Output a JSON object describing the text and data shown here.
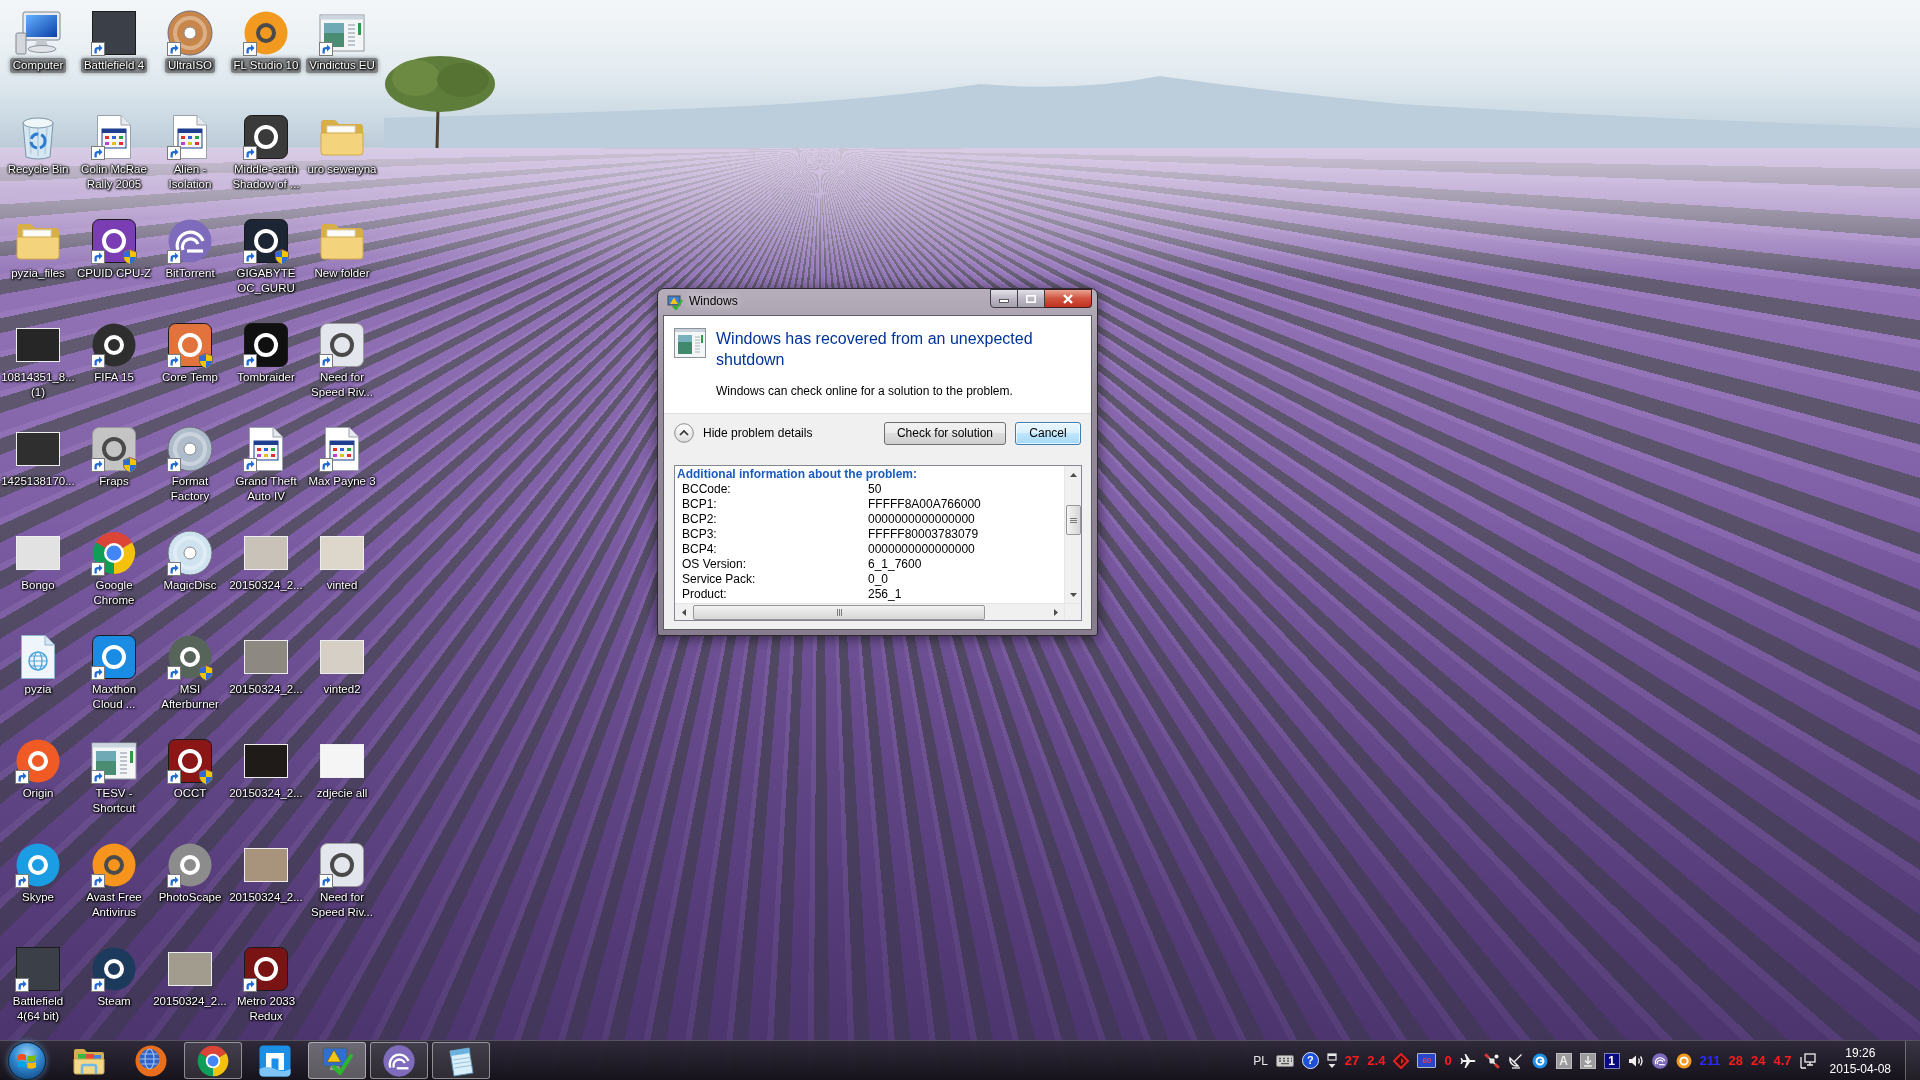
{
  "desktop_icons": [
    {
      "label": "Computer",
      "kind": "computer",
      "shortcut": false,
      "shield": false
    },
    {
      "label": "Battlefield 4",
      "kind": "cover",
      "color": "#3b3f47",
      "shortcut": true,
      "shield": false
    },
    {
      "label": "UltraISO",
      "kind": "disc",
      "color": "#c8864a",
      "shortcut": true,
      "shield": false
    },
    {
      "label": "FL Studio 10",
      "kind": "round",
      "color": "#f29a1f",
      "shortcut": true,
      "shield": false
    },
    {
      "label": "Vindictus EU",
      "kind": "window",
      "shortcut": true,
      "shield": false
    },
    {
      "label": "Recycle Bin",
      "kind": "recyclebin",
      "shortcut": false,
      "shield": false
    },
    {
      "label": "Colin McRae Rally 2005",
      "kind": "document",
      "shortcut": true,
      "shield": false
    },
    {
      "label": "Alien - Isolation",
      "kind": "document",
      "shortcut": true,
      "shield": false
    },
    {
      "label": "Middle-earth Shadow of ...",
      "kind": "tile",
      "color": "#3a3a3a",
      "shortcut": true,
      "shield": false
    },
    {
      "label": "uro seweryna",
      "kind": "folder",
      "shortcut": false,
      "shield": false
    },
    {
      "label": "pyzia_files",
      "kind": "folder",
      "shortcut": false,
      "shield": false
    },
    {
      "label": "CPUID CPU-Z",
      "kind": "tile",
      "color": "#7a3db3",
      "shortcut": true,
      "shield": true
    },
    {
      "label": "BitTorrent",
      "kind": "torrent",
      "shortcut": true,
      "shield": false
    },
    {
      "label": "GIGABYTE OC_GURU",
      "kind": "tile",
      "color": "#1c2533",
      "shortcut": true,
      "shield": true
    },
    {
      "label": "New folder",
      "kind": "folder",
      "shortcut": false,
      "shield": false
    },
    {
      "label": "10814351_8... (1)",
      "kind": "photo",
      "color": "#262626",
      "shortcut": false,
      "shield": false
    },
    {
      "label": "FIFA 15",
      "kind": "round",
      "color": "#2e2e2e",
      "shortcut": true,
      "shield": false
    },
    {
      "label": "Core Temp",
      "kind": "tile",
      "color": "#e2733c",
      "shortcut": true,
      "shield": true
    },
    {
      "label": "Tombraider",
      "kind": "tile",
      "color": "#101010",
      "shortcut": true,
      "shield": false
    },
    {
      "label": "Need for Speed Riv...",
      "kind": "tile",
      "color": "#e4e6ee",
      "shortcut": true,
      "shield": false
    },
    {
      "label": "1425138170...",
      "kind": "photo",
      "color": "#2f2f2f",
      "shortcut": false,
      "shield": false
    },
    {
      "label": "Fraps",
      "kind": "tile",
      "color": "#c4c4c4",
      "shortcut": true,
      "shield": true
    },
    {
      "label": "Format Factory",
      "kind": "disc",
      "color": "#aebccb",
      "shortcut": true,
      "shield": false
    },
    {
      "label": "Grand Theft Auto IV",
      "kind": "document",
      "shortcut": true,
      "shield": false
    },
    {
      "label": "Max Payne 3",
      "kind": "document",
      "shortcut": true,
      "shield": false
    },
    {
      "label": "Bongo",
      "kind": "photo",
      "color": "#e2e2e2",
      "shortcut": false,
      "shield": false
    },
    {
      "label": "Google Chrome",
      "kind": "chrome",
      "shortcut": true,
      "shield": false
    },
    {
      "label": "MagicDisc",
      "kind": "disc",
      "color": "#cfe2f0",
      "shortcut": true,
      "shield": false
    },
    {
      "label": "20150324_2...",
      "kind": "photo",
      "color": "#c9c2b8",
      "shortcut": false,
      "shield": false
    },
    {
      "label": "vinted",
      "kind": "photo",
      "color": "#ddd6cb",
      "shortcut": false,
      "shield": false
    },
    {
      "label": "pyzia",
      "kind": "webpage",
      "shortcut": false,
      "shield": false
    },
    {
      "label": "Maxthon Cloud ...",
      "kind": "tile",
      "color": "#1a8ce3",
      "shortcut": true,
      "shield": false
    },
    {
      "label": "MSI Afterburner",
      "kind": "round",
      "color": "#56645a",
      "shortcut": true,
      "shield": true
    },
    {
      "label": "20150324_2...",
      "kind": "photo",
      "color": "#8d8881",
      "shortcut": false,
      "shield": false
    },
    {
      "label": "vinted2",
      "kind": "photo",
      "color": "#d6cfc5",
      "shortcut": false,
      "shield": false
    },
    {
      "label": "Origin",
      "kind": "round",
      "color": "#f05a24",
      "shortcut": true,
      "shield": false
    },
    {
      "label": "TESV - Shortcut",
      "kind": "window",
      "shortcut": true,
      "shield": false
    },
    {
      "label": "OCCT",
      "kind": "tile",
      "color": "#8a1616",
      "shortcut": true,
      "shield": true
    },
    {
      "label": "20150324_2...",
      "kind": "photo",
      "color": "#1e1b19",
      "shortcut": false,
      "shield": false
    },
    {
      "label": "zdjecie all",
      "kind": "photo",
      "color": "#f5f5f5",
      "shortcut": false,
      "shield": false
    },
    {
      "label": "Skype",
      "kind": "round",
      "color": "#1a9de2",
      "shortcut": true,
      "shield": false
    },
    {
      "label": "Avast Free Antivirus",
      "kind": "round",
      "color": "#f7941d",
      "shortcut": true,
      "shield": false
    },
    {
      "label": "PhotoScape",
      "kind": "round",
      "color": "#8c8c8c",
      "shortcut": true,
      "shield": false
    },
    {
      "label": "20150324_2...",
      "kind": "photo",
      "color": "#a8937d",
      "shortcut": false,
      "shield": false
    },
    {
      "label": "Need for Speed Riv...",
      "kind": "tile",
      "color": "#e4e6ee",
      "shortcut": true,
      "shield": false
    },
    {
      "label": "Battlefield 4(64 bit)",
      "kind": "cover",
      "color": "#3b3f47",
      "shortcut": true,
      "shield": false
    },
    {
      "label": "Steam",
      "kind": "round",
      "color": "#1b3a5c",
      "shortcut": true,
      "shield": false
    },
    {
      "label": "20150324_2...",
      "kind": "photo",
      "color": "#a29c8f",
      "shortcut": false,
      "shield": false
    },
    {
      "label": "Metro 2033 Redux",
      "kind": "tile",
      "color": "#7a1414",
      "shortcut": true,
      "shield": false
    }
  ],
  "dialog": {
    "title": "Windows",
    "heading": "Windows has recovered from an unexpected shutdown",
    "message": "Windows can check online for a solution to the problem.",
    "details_toggle": {
      "label": "Hide problem details",
      "expanded": true
    },
    "buttons": [
      {
        "label": "Check for solution",
        "default": false
      },
      {
        "label": "Cancel",
        "default": true
      }
    ],
    "details": {
      "heading": "Additional information about the problem:",
      "rows": [
        {
          "name": "BCCode:",
          "value": "50"
        },
        {
          "name": "BCP1:",
          "value": "FFFFF8A00A766000"
        },
        {
          "name": "BCP2:",
          "value": "0000000000000000"
        },
        {
          "name": "BCP3:",
          "value": "FFFFF80003783079"
        },
        {
          "name": "BCP4:",
          "value": "0000000000000000"
        },
        {
          "name": "OS Version:",
          "value": "6_1_7600"
        },
        {
          "name": "Service Pack:",
          "value": "0_0"
        },
        {
          "name": "Product:",
          "value": "256_1"
        }
      ]
    }
  },
  "taskbar": {
    "buttons": [
      {
        "kind": "folder",
        "running": false,
        "selected": false
      },
      {
        "kind": "firefox",
        "running": false,
        "selected": false
      },
      {
        "kind": "chrome",
        "running": true,
        "selected": false
      },
      {
        "kind": "maxthon",
        "running": false,
        "selected": false
      },
      {
        "kind": "reports",
        "running": true,
        "selected": true
      },
      {
        "kind": "torrent",
        "running": true,
        "selected": false
      },
      {
        "kind": "notepad",
        "running": true,
        "selected": false
      }
    ],
    "tray": [
      {
        "kind": "language",
        "text": "PL"
      },
      {
        "kind": "keyboard"
      },
      {
        "kind": "help",
        "text": "?"
      },
      {
        "kind": "restore"
      },
      {
        "kind": "text",
        "text": "27",
        "color": "#ff1c1c"
      },
      {
        "kind": "text",
        "text": "2.4",
        "color": "#ff1c1c"
      },
      {
        "kind": "diamond"
      },
      {
        "kind": "screen",
        "text": "60"
      },
      {
        "kind": "text",
        "text": "0",
        "color": "#ff1c1c"
      },
      {
        "kind": "plane"
      },
      {
        "kind": "satellite"
      },
      {
        "kind": "dish"
      },
      {
        "kind": "browser"
      },
      {
        "kind": "letter",
        "text": "A"
      },
      {
        "kind": "download"
      },
      {
        "kind": "badge",
        "text": "1"
      },
      {
        "kind": "speaker"
      },
      {
        "kind": "torrent"
      },
      {
        "kind": "ring"
      },
      {
        "kind": "text",
        "text": "211",
        "color": "#2a2aff"
      },
      {
        "kind": "text",
        "text": "28",
        "color": "#ff1c1c"
      },
      {
        "kind": "text",
        "text": "24",
        "color": "#ff1c1c"
      },
      {
        "kind": "text",
        "text": "4.7",
        "color": "#ff1c1c"
      },
      {
        "kind": "network"
      }
    ],
    "clock": {
      "time": "19:26",
      "date": "2015-04-08"
    }
  }
}
